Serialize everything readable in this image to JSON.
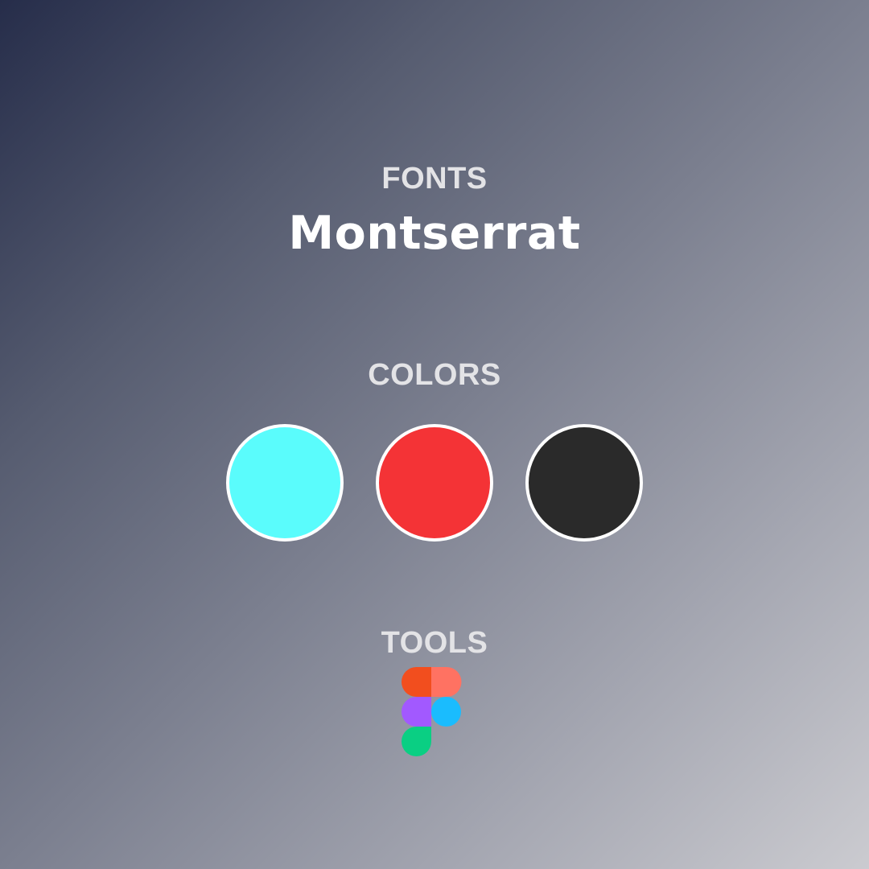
{
  "sections": {
    "fonts": {
      "heading": "FONTS",
      "font_name": "Montserrat"
    },
    "colors": {
      "heading": "COLORS",
      "swatches": [
        "#5afcfc",
        "#f43336",
        "#2a2a2a"
      ]
    },
    "tools": {
      "heading": "TOOLS",
      "items": [
        {
          "icon": "figma-icon",
          "colors": [
            "#f24e1e",
            "#ff7262",
            "#a259ff",
            "#1abcfe",
            "#0acf83"
          ]
        }
      ]
    }
  }
}
